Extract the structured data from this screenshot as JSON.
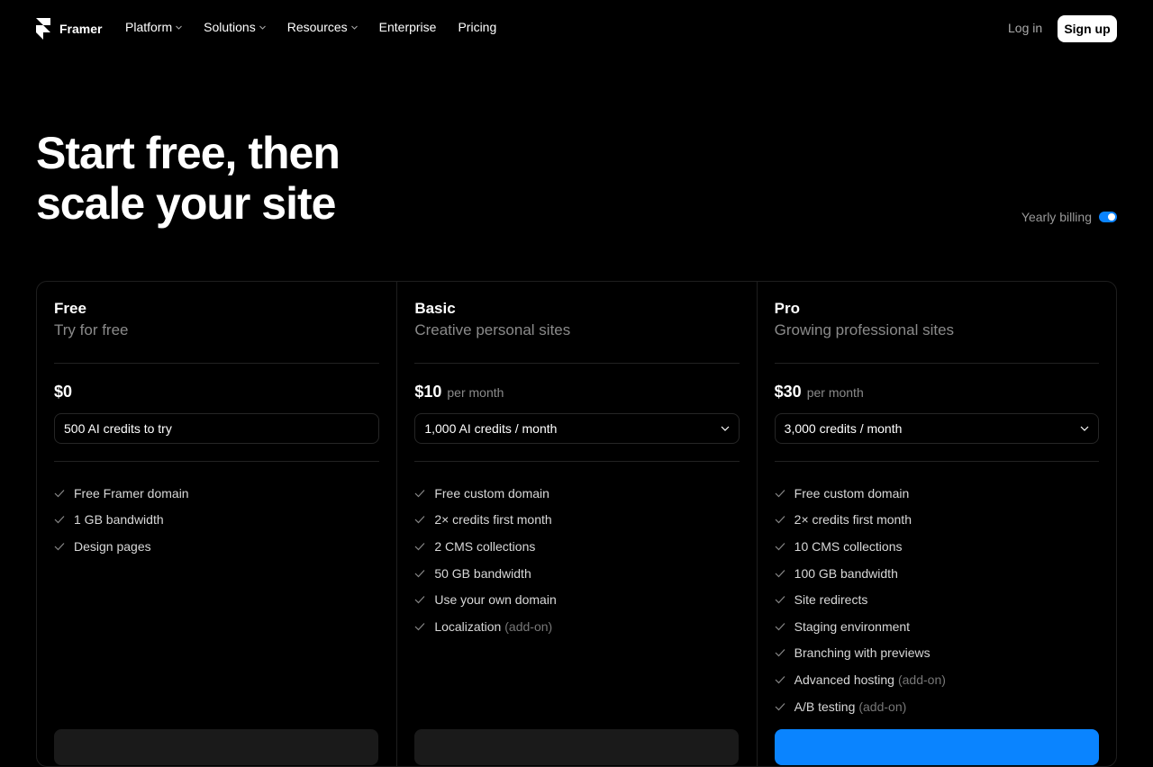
{
  "nav": {
    "brand": "Framer",
    "links": [
      {
        "label": "Platform",
        "dropdown": true
      },
      {
        "label": "Solutions",
        "dropdown": true
      },
      {
        "label": "Resources",
        "dropdown": true
      },
      {
        "label": "Enterprise",
        "dropdown": false
      },
      {
        "label": "Pricing",
        "dropdown": false
      }
    ],
    "login": "Log in",
    "signup": "Sign up"
  },
  "hero": {
    "title_line1": "Start free, then",
    "title_line2": "scale your site"
  },
  "billing": {
    "label": "Yearly billing",
    "enabled": true,
    "toggle_color": "#0a84ff"
  },
  "plans": [
    {
      "name": "Free",
      "description": "Try for free",
      "price": "$0",
      "period": "",
      "credits": "500 AI credits to try",
      "credits_dropdown": false,
      "features": [
        {
          "text": "Free Framer domain",
          "addon": ""
        },
        {
          "text": "1 GB bandwidth",
          "addon": ""
        },
        {
          "text": "Design pages",
          "addon": ""
        }
      ],
      "cta_primary": false
    },
    {
      "name": "Basic",
      "description": "Creative personal sites",
      "price": "$10",
      "period": "per month",
      "credits": "1,000 AI credits / month",
      "credits_dropdown": true,
      "features": [
        {
          "text": "Free custom domain",
          "addon": ""
        },
        {
          "text": "2× credits first month",
          "addon": ""
        },
        {
          "text": "2 CMS collections",
          "addon": ""
        },
        {
          "text": "50 GB bandwidth",
          "addon": ""
        },
        {
          "text": "Use your own domain",
          "addon": ""
        },
        {
          "text": "Localization",
          "addon": "(add-on)"
        }
      ],
      "cta_primary": false
    },
    {
      "name": "Pro",
      "description": "Growing professional sites",
      "price": "$30",
      "period": "per month",
      "credits": "3,000 credits / month",
      "credits_dropdown": true,
      "features": [
        {
          "text": "Free custom domain",
          "addon": ""
        },
        {
          "text": "2× credits first month",
          "addon": ""
        },
        {
          "text": "10 CMS collections",
          "addon": ""
        },
        {
          "text": "100 GB bandwidth",
          "addon": ""
        },
        {
          "text": "Site redirects",
          "addon": ""
        },
        {
          "text": "Staging environment",
          "addon": ""
        },
        {
          "text": "Branching with previews",
          "addon": ""
        },
        {
          "text": "Advanced hosting",
          "addon": "(add-on)"
        },
        {
          "text": "A/B testing",
          "addon": "(add-on)"
        }
      ],
      "cta_primary": true
    }
  ],
  "colors": {
    "background": "#000000",
    "accent": "#0a84ff",
    "muted_text": "#8a8a8a"
  }
}
